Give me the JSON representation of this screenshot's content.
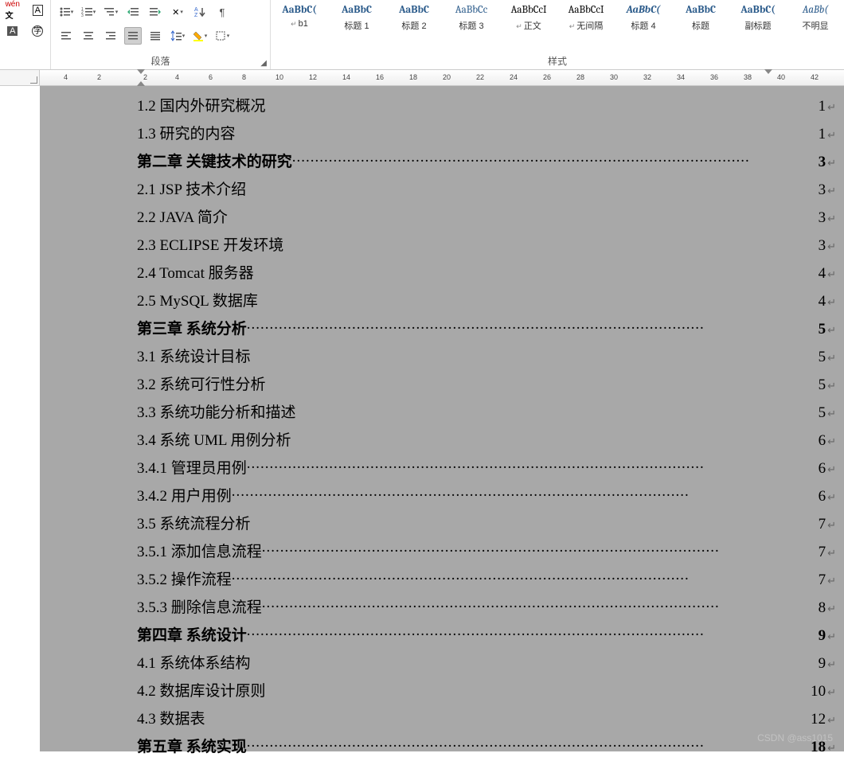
{
  "group_labels": {
    "paragraph": "段落",
    "styles": "样式"
  },
  "styles": [
    {
      "preview": "AaBbC(",
      "name": "b1",
      "ret": true,
      "cls": "bold"
    },
    {
      "preview": "AaBbC",
      "name": "标题 1",
      "cls": "bold"
    },
    {
      "preview": "AaBbC",
      "name": "标题 2",
      "cls": "bold"
    },
    {
      "preview": "AaBbCc",
      "name": "标题 3",
      "cls": ""
    },
    {
      "preview": "AaBbCcI",
      "name": "正文",
      "ret": true,
      "cls": "black"
    },
    {
      "preview": "AaBbCcI",
      "name": "无间隔",
      "ret": true,
      "cls": "black"
    },
    {
      "preview": "AaBbC(",
      "name": "标题 4",
      "cls": "bold italic"
    },
    {
      "preview": "AaBbC",
      "name": "标题",
      "cls": "bold"
    },
    {
      "preview": "AaBbC(",
      "name": "副标题",
      "cls": "bold"
    },
    {
      "preview": "AaBb(",
      "name": "不明显",
      "cls": "italic"
    }
  ],
  "ruler_ticks": [
    4,
    2,
    2,
    4,
    6,
    8,
    10,
    12,
    14,
    16,
    18,
    20,
    22,
    24,
    26,
    28,
    30,
    32,
    34,
    36,
    38,
    40,
    42
  ],
  "toc": [
    {
      "t": "1.2 国内外研究概况",
      "p": "1",
      "bold": false,
      "dots": false
    },
    {
      "t": "1.3 研究的内容",
      "p": "1",
      "bold": false,
      "dots": false
    },
    {
      "t": "第二章 关键技术的研究",
      "p": "3",
      "bold": true,
      "dots": true
    },
    {
      "t": "2.1 JSP 技术介绍",
      "p": "3",
      "bold": false,
      "dots": false
    },
    {
      "t": "2.2 JAVA 简介",
      "p": "3",
      "bold": false,
      "dots": false
    },
    {
      "t": "2.3 ECLIPSE 开发环境",
      "p": "3",
      "bold": false,
      "dots": false
    },
    {
      "t": "2.4 Tomcat 服务器",
      "p": "4",
      "bold": false,
      "dots": false
    },
    {
      "t": "2.5 MySQL 数据库",
      "p": "4",
      "bold": false,
      "dots": false
    },
    {
      "t": "第三章 系统分析",
      "p": "5",
      "bold": true,
      "dots": true
    },
    {
      "t": "3.1 系统设计目标",
      "p": "5",
      "bold": false,
      "dots": false
    },
    {
      "t": "3.2 系统可行性分析",
      "p": "5",
      "bold": false,
      "dots": false
    },
    {
      "t": "3.3 系统功能分析和描述",
      "p": "5",
      "bold": false,
      "dots": false
    },
    {
      "t": "3.4 系统 UML 用例分析",
      "p": "6",
      "bold": false,
      "dots": false
    },
    {
      "t": "3.4.1 管理员用例",
      "p": "6",
      "bold": false,
      "dots": true
    },
    {
      "t": "3.4.2 用户用例",
      "p": "6",
      "bold": false,
      "dots": true
    },
    {
      "t": "3.5 系统流程分析",
      "p": "7",
      "bold": false,
      "dots": false
    },
    {
      "t": "3.5.1 添加信息流程",
      "p": "7",
      "bold": false,
      "dots": true
    },
    {
      "t": "3.5.2 操作流程",
      "p": "7",
      "bold": false,
      "dots": true
    },
    {
      "t": "3.5.3 删除信息流程",
      "p": "8",
      "bold": false,
      "dots": true
    },
    {
      "t": "第四章 系统设计",
      "p": "9",
      "bold": true,
      "dots": true
    },
    {
      "t": "4.1 系统体系结构",
      "p": "9",
      "bold": false,
      "dots": false
    },
    {
      "t": "4.2 数据库设计原则",
      "p": "10",
      "bold": false,
      "dots": false
    },
    {
      "t": "4.3 数据表",
      "p": "12",
      "bold": false,
      "dots": false
    },
    {
      "t": "第五章 系统实现",
      "p": "18",
      "bold": true,
      "dots": true
    }
  ],
  "watermark": "CSDN @ass1015"
}
